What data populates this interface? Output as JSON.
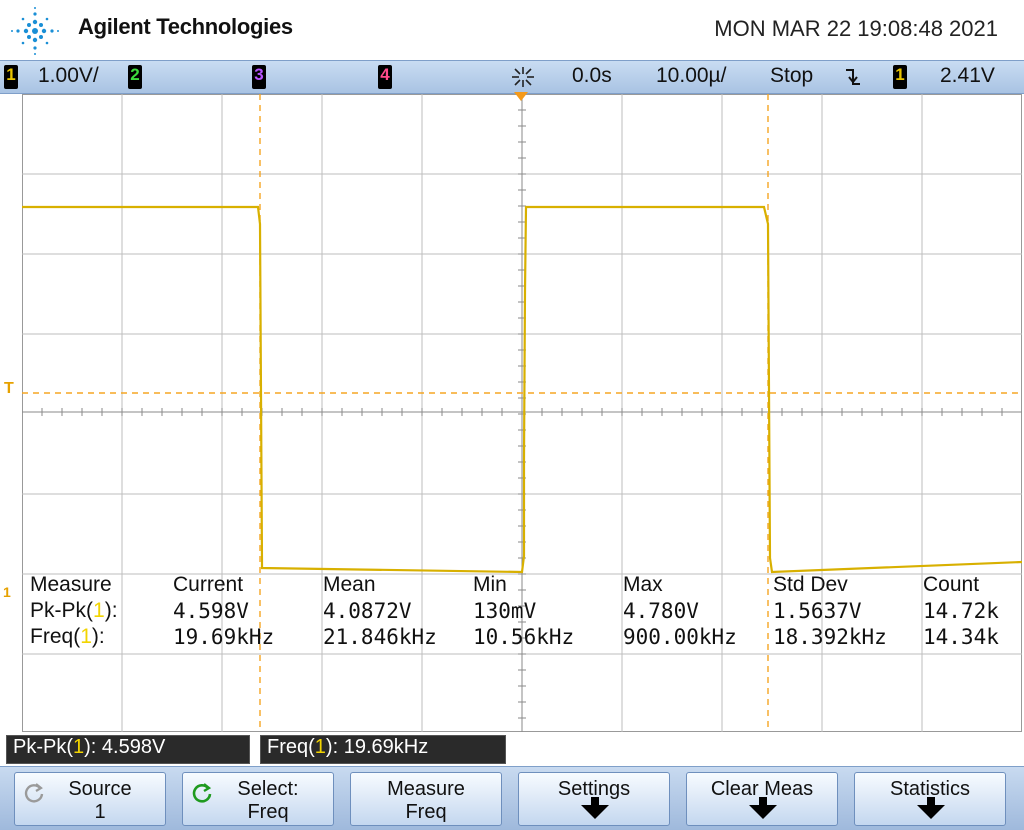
{
  "header": {
    "brand": "Agilent Technologies",
    "datetime": "MON MAR 22 19:08:48 2021",
    "logo_icon": "agilent-spark-logo"
  },
  "status_bar": {
    "ch1_num": "1",
    "ch1_scale": "1.00V/",
    "ch2_num": "2",
    "ch3_num": "3",
    "ch4_num": "4",
    "trigger_icon": "trigger-spark-icon",
    "delay": "0.0s",
    "timebase": "10.00µ/",
    "run_state": "Stop",
    "edge_icon": "falling-edge-icon",
    "trig_source": "1",
    "trig_level": "2.41V"
  },
  "colors": {
    "ch1": "#e8c400",
    "ch2": "#3ddc3d",
    "ch3": "#b855ff",
    "ch4": "#ff4a8a",
    "trace": "#d8b000",
    "cursor": "#f59a1a",
    "grid": "#b8b8b8"
  },
  "markers": {
    "trigger_level": "T",
    "ground": "1"
  },
  "measurements": {
    "headers": [
      "Measure",
      "Current",
      "Mean",
      "Min",
      "Max",
      "Std Dev",
      "Count"
    ],
    "rows": [
      {
        "name": "Pk-Pk",
        "channel": "1",
        "values": [
          "4.598V",
          "4.0872V",
          "130mV",
          "4.780V",
          "1.5637V",
          "14.72k"
        ]
      },
      {
        "name": "Freq",
        "channel": "1",
        "values": [
          "19.69kHz",
          "21.846kHz",
          "10.56kHz",
          "900.00kHz",
          "18.392kHz",
          "14.34k"
        ]
      }
    ]
  },
  "readouts": [
    {
      "name": "Pk-Pk",
      "channel": "1",
      "value": "4.598V"
    },
    {
      "name": "Freq",
      "channel": "1",
      "value": "19.69kHz"
    }
  ],
  "softkeys": [
    {
      "line1": "Source",
      "line2": "1",
      "icon": "rotate-knob-icon"
    },
    {
      "line1": "Select:",
      "line2": "Freq",
      "icon": "rotate-knob-icon"
    },
    {
      "line1": "Measure",
      "line2": "Freq"
    },
    {
      "line1": "Settings",
      "icon": "down-arrow-icon"
    },
    {
      "line1": "Clear Meas",
      "icon": "down-arrow-icon"
    },
    {
      "line1": "Statistics",
      "icon": "down-arrow-icon"
    }
  ]
}
